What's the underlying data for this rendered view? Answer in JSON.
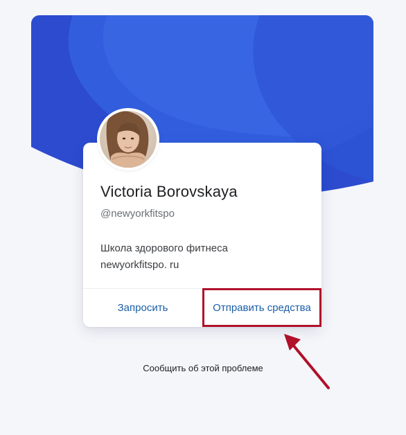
{
  "profile": {
    "name": "Victoria Borovskaya",
    "handle": "@newyorkfitspo",
    "bio_line1": "Школа здорового фитнеса",
    "bio_line2": "newyorkfitspo. ru"
  },
  "actions": {
    "request_label": "Запросить",
    "send_label": "Отправить средства"
  },
  "footer": {
    "report_label": "Сообщить об этой проблеме"
  },
  "colors": {
    "hero_blue": "#2c4fd0",
    "link_blue": "#1a5ea8",
    "highlight_red": "#b0102a"
  },
  "icons": {
    "avatar": "profile-photo",
    "annotation": "red-arrow"
  }
}
